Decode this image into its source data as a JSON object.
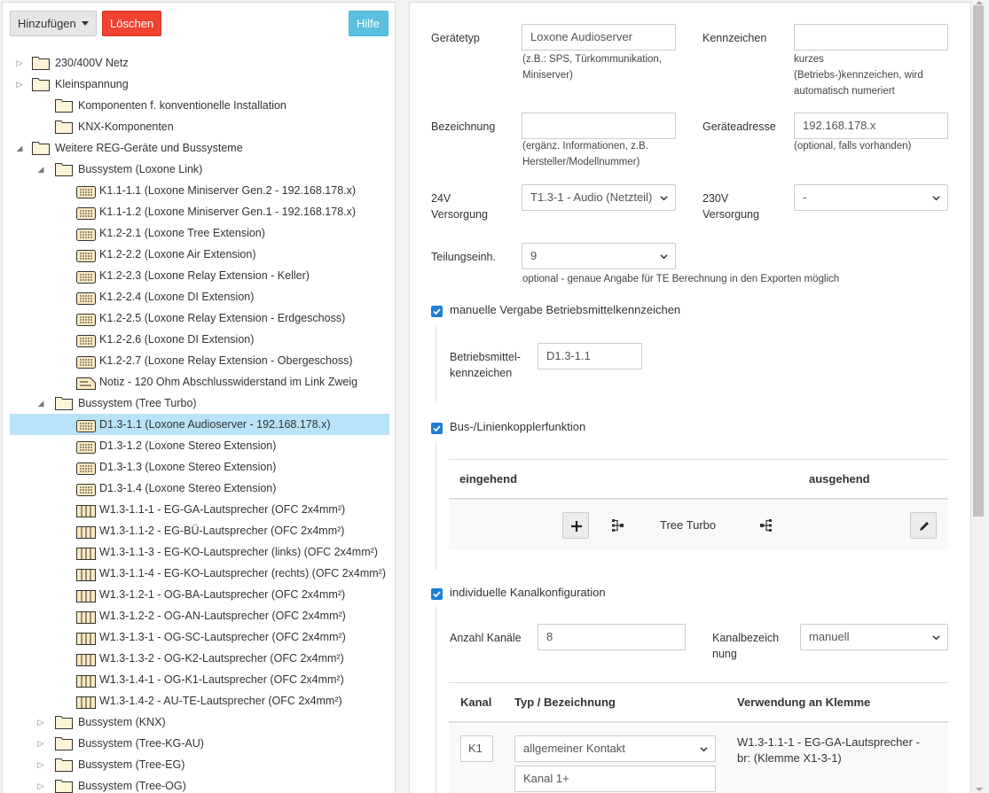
{
  "toolbar": {
    "add_label": "Hinzufügen",
    "delete_label": "Löschen",
    "help_label": "Hilfe"
  },
  "tree": [
    {
      "label": "230/400V Netz",
      "icon": "folder-icon",
      "toggle": "collapsed"
    },
    {
      "label": "Kleinspannung",
      "icon": "folder-icon",
      "toggle": "collapsed"
    },
    {
      "label": "Komponenten f. konventionelle Installation",
      "icon": "folder-icon",
      "toggle": "none"
    },
    {
      "label": "KNX-Komponenten",
      "icon": "folder-icon",
      "toggle": "none"
    },
    {
      "label": "Weitere REG-Geräte und Bussysteme",
      "icon": "folder-icon",
      "toggle": "expanded"
    },
    {
      "label": "Bussystem (Loxone Link)",
      "icon": "folder-icon",
      "toggle": "expanded"
    },
    {
      "label": "K1.1-1.1 (Loxone Miniserver Gen.2 - 192.168.178.x)",
      "icon": "device-icon",
      "toggle": "none"
    },
    {
      "label": "K1.1-1.2 (Loxone Miniserver Gen.1 - 192.168.178.x)",
      "icon": "device-icon",
      "toggle": "none"
    },
    {
      "label": "K1.2-2.1 (Loxone Tree Extension)",
      "icon": "device-icon",
      "toggle": "none"
    },
    {
      "label": "K1.2-2.2 (Loxone Air Extension)",
      "icon": "device-icon",
      "toggle": "none"
    },
    {
      "label": "K1.2-2.3 (Loxone Relay Extension - Keller)",
      "icon": "device-icon",
      "toggle": "none"
    },
    {
      "label": "K1.2-2.4 (Loxone DI Extension)",
      "icon": "device-icon",
      "toggle": "none"
    },
    {
      "label": "K1.2-2.5 (Loxone Relay Extension - Erdgeschoss)",
      "icon": "device-icon",
      "toggle": "none"
    },
    {
      "label": "K1.2-2.6 (Loxone DI Extension)",
      "icon": "device-icon",
      "toggle": "none"
    },
    {
      "label": "K1.2-2.7 (Loxone Relay Extension - Obergeschoss)",
      "icon": "device-icon",
      "toggle": "none"
    },
    {
      "label": "Notiz - 120 Ohm Abschlusswiderstand im Link Zweig",
      "icon": "note-icon",
      "toggle": "none"
    },
    {
      "label": "Bussystem (Tree Turbo)",
      "icon": "folder-icon",
      "toggle": "expanded"
    },
    {
      "label": "D1.3-1.1 (Loxone Audioserver - 192.168.178.x)",
      "icon": "device-icon",
      "toggle": "none",
      "selected": true
    },
    {
      "label": "D1.3-1.2 (Loxone Stereo Extension)",
      "icon": "device-icon",
      "toggle": "none"
    },
    {
      "label": "D1.3-1.3 (Loxone Stereo Extension)",
      "icon": "device-icon",
      "toggle": "none"
    },
    {
      "label": "D1.3-1.4 (Loxone Stereo Extension)",
      "icon": "device-icon",
      "toggle": "none"
    },
    {
      "label": "W1.3-1.1-1 - EG-GA-Lautsprecher (OFC 2x4mm²)",
      "icon": "cable-icon",
      "toggle": "none"
    },
    {
      "label": "W1.3-1.1-2 - EG-BÜ-Lautsprecher (OFC 2x4mm²)",
      "icon": "cable-icon",
      "toggle": "none"
    },
    {
      "label": "W1.3-1.1-3 - EG-KO-Lautsprecher (links) (OFC 2x4mm²)",
      "icon": "cable-icon",
      "toggle": "none"
    },
    {
      "label": "W1.3-1.1-4 - EG-KO-Lautsprecher (rechts) (OFC 2x4mm²)",
      "icon": "cable-icon",
      "toggle": "none"
    },
    {
      "label": "W1.3-1.2-1 - OG-BA-Lautsprecher (OFC 2x4mm²)",
      "icon": "cable-icon",
      "toggle": "none"
    },
    {
      "label": "W1.3-1.2-2 - OG-AN-Lautsprecher (OFC 2x4mm²)",
      "icon": "cable-icon",
      "toggle": "none"
    },
    {
      "label": "W1.3-1.3-1 - OG-SC-Lautsprecher (OFC 2x4mm²)",
      "icon": "cable-icon",
      "toggle": "none"
    },
    {
      "label": "W1.3-1.3-2 - OG-K2-Lautsprecher (OFC 2x4mm²)",
      "icon": "cable-icon",
      "toggle": "none"
    },
    {
      "label": "W1.3-1.4-1 - OG-K1-Lautsprecher (OFC 2x4mm²)",
      "icon": "cable-icon",
      "toggle": "none"
    },
    {
      "label": "W1.3-1.4-2 - AU-TE-Lautsprecher (OFC 2x4mm²)",
      "icon": "cable-icon",
      "toggle": "none"
    },
    {
      "label": "Bussystem (KNX)",
      "icon": "folder-icon",
      "toggle": "collapsed"
    },
    {
      "label": "Bussystem (Tree-KG-AU)",
      "icon": "folder-icon",
      "toggle": "collapsed"
    },
    {
      "label": "Bussystem (Tree-EG)",
      "icon": "folder-icon",
      "toggle": "collapsed"
    },
    {
      "label": "Bussystem (Tree-OG)",
      "icon": "folder-icon",
      "toggle": "collapsed"
    }
  ],
  "form": {
    "geraetetyp": {
      "label": "Gerätetyp",
      "value": "Loxone Audioserver",
      "help": [
        "(z.B.: SPS, Türkommunikation,",
        "Miniserver)"
      ]
    },
    "kennzeichen": {
      "label": "Kennzeichen",
      "value": "",
      "help": [
        "kurzes",
        "(Betriebs-)kennzeichen, wird",
        "automatisch numeriert"
      ]
    },
    "bezeichnung": {
      "label": "Bezeichnung",
      "value": "",
      "help": [
        "(ergänz. Informationen, z.B.",
        "Hersteller/Modellnummer)"
      ]
    },
    "geraeteadresse": {
      "label": "Geräteadresse",
      "value": "192.168.178.x",
      "help": [
        "(optional, falls vorhanden)"
      ]
    },
    "versorgung24": {
      "label": [
        "24V",
        "Versorgung"
      ],
      "value": "T1.3-1 - Audio (Netzteil)"
    },
    "versorgung230": {
      "label": [
        "230V",
        "Versorgung"
      ],
      "value": "-"
    },
    "teilung": {
      "label": "Teilungseinh.",
      "value": "9",
      "help": "optional - genaue Angabe für TE Berechnung in den Exporten möglich"
    },
    "manuelle_vergabe": {
      "label": "manuelle Vergabe Betriebsmittelkennzeichen",
      "checked": true
    },
    "betriebsmittel": {
      "label": [
        "Betriebsmittel-",
        "kennzeichen"
      ],
      "value": "D1.3-1.1"
    },
    "bus_koppler": {
      "label": "Bus-/Linienkopplerfunktion",
      "checked": true
    },
    "bus_table": {
      "col_in": "eingehend",
      "col_out": "ausgehend",
      "row_name": "Tree Turbo"
    },
    "kanal_konfig": {
      "label": "individuelle Kanalkonfiguration",
      "checked": true
    },
    "anzahl_kanaele": {
      "label": "Anzahl Kanäle",
      "value": "8"
    },
    "kanalbezeichnung": {
      "label": [
        "Kanalbezeich",
        "nung"
      ],
      "value": "manuell"
    },
    "channel_table": {
      "headers": [
        "Kanal",
        "Typ / Bezeichnung",
        "Verwendung an Klemme"
      ],
      "rows": [
        {
          "kanal": "K1",
          "typ": "allgemeiner Kontakt",
          "bezeichnung": "Kanal 1+",
          "verwendung": [
            "W1.3-1.1-1 - EG-GA-Lautsprecher -",
            "br: (Klemme X1-3-1)"
          ]
        }
      ]
    }
  },
  "colors": {
    "delete": "#f0432f",
    "help": "#5bc0de",
    "selected": "#b9e3f8",
    "checkbox": "#1e7fd6"
  }
}
